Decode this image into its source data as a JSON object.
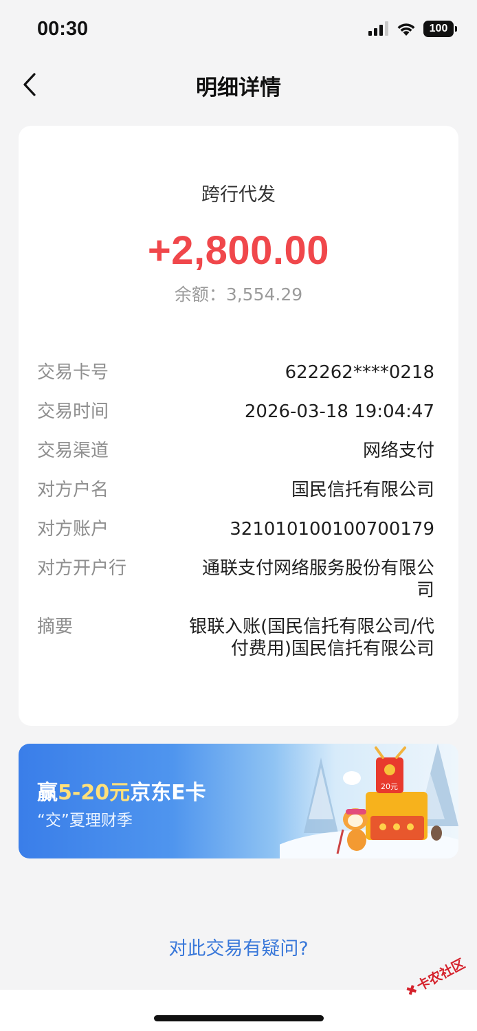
{
  "status_bar": {
    "time": "00:30",
    "battery": "100"
  },
  "nav": {
    "title": "明细详情"
  },
  "transaction": {
    "type": "跨行代发",
    "amount": "+2,800.00",
    "balance": "余额：3,554.29",
    "details": [
      {
        "label": "交易卡号",
        "value": "622262****0218"
      },
      {
        "label": "交易时间",
        "value": "2026-03-18 19:04:47"
      },
      {
        "label": "交易渠道",
        "value": "网络支付"
      },
      {
        "label": "对方户名",
        "value": "国民信托有限公司"
      },
      {
        "label": "对方账户",
        "value": "321010100100700179"
      },
      {
        "label": "对方开户行",
        "value": "通联支付网络服务股份有限公司"
      },
      {
        "label": "摘要",
        "value": "银联入账(国民信托有限公司/代付费用)国民信托有限公司"
      }
    ]
  },
  "banner": {
    "title_prefix": "赢",
    "title_highlight": "5-20元",
    "title_suffix": "京东E卡",
    "subtitle": "“交”夏理财季",
    "coupon_label": "20元"
  },
  "footer": {
    "question_link": "对此交易有疑问?"
  },
  "watermark": {
    "text": "卡农社区"
  },
  "colors": {
    "amount": "#f0474b",
    "link": "#3877d9",
    "banner_blue": "#3a7ee9"
  },
  "icons": [
    "signal-icon",
    "wifi-icon",
    "battery-icon",
    "back-arrow-icon"
  ]
}
